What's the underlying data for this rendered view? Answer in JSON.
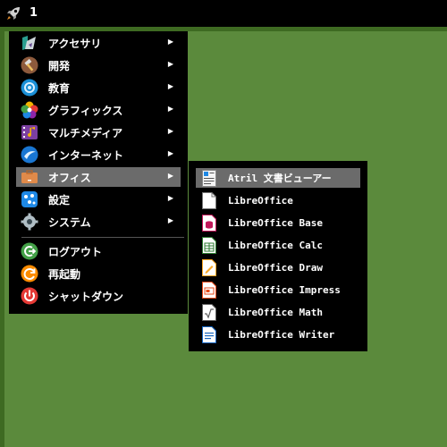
{
  "panel": {
    "launcher_icon": "rocket-icon",
    "workspace": "1"
  },
  "menu": {
    "items": [
      {
        "label": "アクセサリ",
        "icon": "accessories-icon",
        "arrow": "▶"
      },
      {
        "label": "開発",
        "icon": "development-hammer-icon",
        "arrow": "▶"
      },
      {
        "label": "教育",
        "icon": "education-icon",
        "arrow": "▶"
      },
      {
        "label": "グラフィックス",
        "icon": "graphics-flower-icon",
        "arrow": "▶"
      },
      {
        "label": "マルチメディア",
        "icon": "multimedia-icon",
        "arrow": "▶"
      },
      {
        "label": "インターネット",
        "icon": "internet-globe-icon",
        "arrow": "▶"
      },
      {
        "label": "オフィス",
        "icon": "office-briefcase-icon",
        "arrow": "▶"
      },
      {
        "label": "設定",
        "icon": "settings-icon",
        "arrow": "▶"
      },
      {
        "label": "システム",
        "icon": "system-gear-icon",
        "arrow": "▶"
      }
    ],
    "actions": [
      {
        "label": "ログアウト",
        "icon": "logout-icon"
      },
      {
        "label": "再起動",
        "icon": "reboot-icon"
      },
      {
        "label": "シャットダウン",
        "icon": "shutdown-icon"
      }
    ]
  },
  "submenu": {
    "items": [
      {
        "label": "Atril 文書ビューアー",
        "icon": "atril-document-viewer-icon"
      },
      {
        "label": "LibreOffice",
        "icon": "libreoffice-icon"
      },
      {
        "label": "LibreOffice Base",
        "icon": "libreoffice-base-icon"
      },
      {
        "label": "LibreOffice Calc",
        "icon": "libreoffice-calc-icon"
      },
      {
        "label": "LibreOffice Draw",
        "icon": "libreoffice-draw-icon"
      },
      {
        "label": "LibreOffice Impress",
        "icon": "libreoffice-impress-icon"
      },
      {
        "label": "LibreOffice Math",
        "icon": "libreoffice-math-icon"
      },
      {
        "label": "LibreOffice Writer",
        "icon": "libreoffice-writer-icon"
      }
    ]
  },
  "colors": {
    "desktop": "#5b8a3c",
    "panel": "#000000",
    "highlight": "#6b6b6b"
  }
}
